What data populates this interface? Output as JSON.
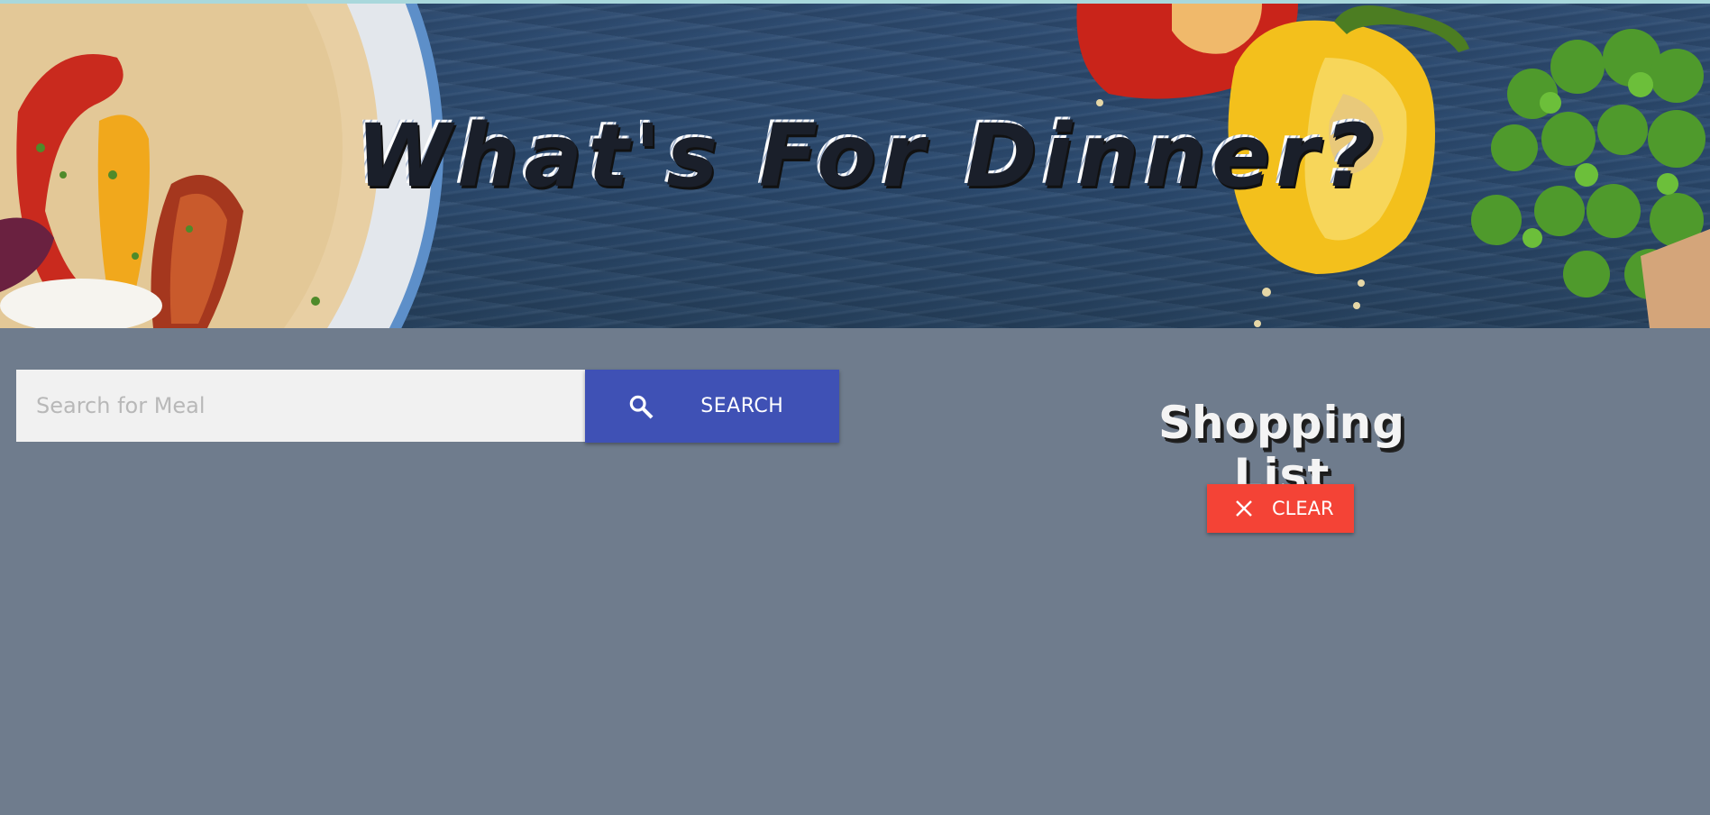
{
  "banner": {
    "title": "What's For Dinner?"
  },
  "search": {
    "placeholder": "Search for Meal",
    "value": "",
    "button_label": "SEARCH",
    "button_icon": "search-icon",
    "button_color": "#3f51b5"
  },
  "shopping_list": {
    "title": "Shopping List",
    "clear_label": "CLEAR",
    "clear_icon": "close-icon",
    "clear_color": "#f44336"
  },
  "colors": {
    "page_background": "#6f7c8d",
    "banner_background": "#2c4b70",
    "input_background": "#f1f1f1"
  }
}
